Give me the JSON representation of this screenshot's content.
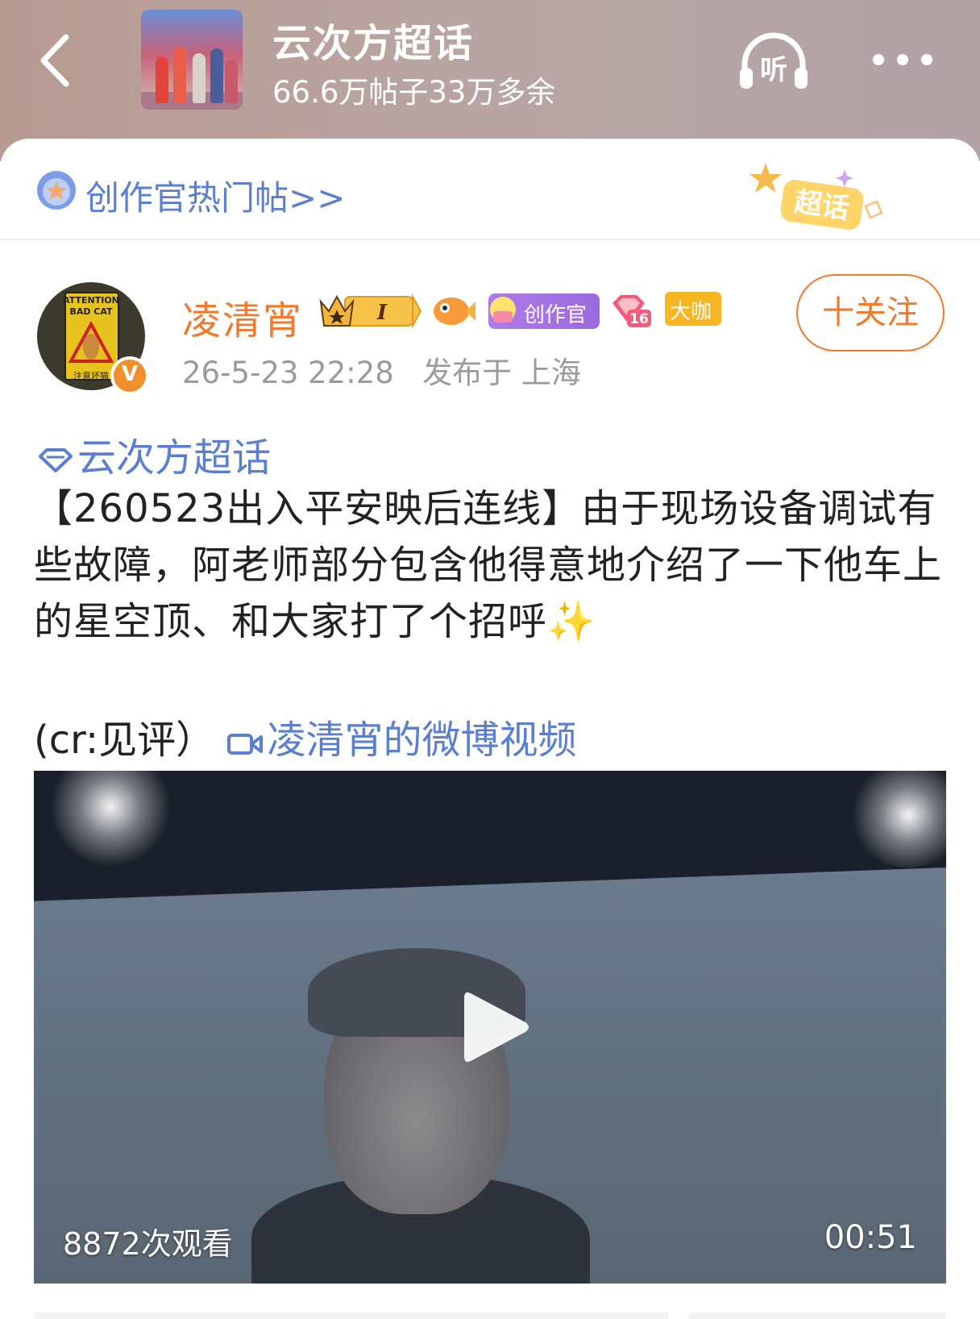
{
  "header": {
    "topic_title": "云次方超话",
    "topic_stats": "66.6万帖子33万多余",
    "listen_label": "听"
  },
  "hot_bar": {
    "label": "创作官热门帖>>",
    "badge_text": "超话"
  },
  "post": {
    "username": "凌清宵",
    "badges": {
      "level_roman": "I",
      "creator_tag": "创作官",
      "level_number": "16",
      "daka_tag": "大咖"
    },
    "verified_mark": "V",
    "avatar_sign_text": [
      "ATTENTION",
      "BAD CAT",
      "注意坏猫"
    ],
    "timestamp": "26-5-23 22:28",
    "location": "发布于 上海",
    "follow_label": "十关注",
    "topic_link": "云次方超话",
    "text_main": "【260523出入平安映后连线】由于现场设备调试有些故障，阿老师部分包含他得意地介绍了一下他车上的星空顶、和大家打了个招呼",
    "text_emoji": "✨",
    "credit": "(cr:见评）",
    "video_link": "凌清宵的微博视频"
  },
  "video": {
    "views": "8872次观看",
    "duration": "00:51"
  },
  "colors": {
    "accent_orange": "#f07a2d",
    "link_blue": "#5a7fd0",
    "creator_purple": "#9b6ae0",
    "daka_gold": "#f6b622"
  }
}
